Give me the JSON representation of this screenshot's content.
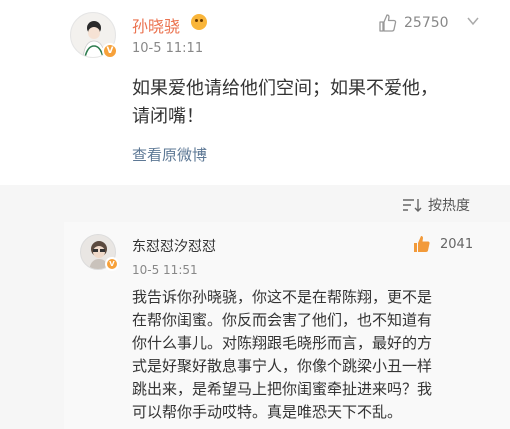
{
  "post": {
    "author_name": "孙晓骁",
    "time": "10-5 11:11",
    "like_count": "25750",
    "text_line1": "如果爱他请给他们空间；如果不爱他，",
    "text_line2": "请闭嘴！",
    "view_original_label": "查看原微博"
  },
  "sort": {
    "label": "按热度"
  },
  "comment": {
    "author_name": "东怼怼汐怼怼",
    "time": "10-5 11:51",
    "like_count": "2041",
    "lines": [
      "我告诉你孙晓骁，你这不是在帮陈翔，更不是",
      "在帮你闺蜜。你反而会害了他们，也不知道有",
      "你什么事儿。对陈翔跟毛晓彤而言，最好的方",
      "式是好聚好散息事宁人，你像个跳梁小丑一样",
      "跳出来，是希望马上把你闺蜜牵扯进来吗？我",
      "可以帮你手动哎特。真是唯恐天下不乱。"
    ]
  },
  "colors": {
    "author_accent": "#eb7350",
    "link": "#5d7895",
    "badge": "#f7a13a",
    "comment_like_icon": "#f29a3a"
  },
  "icons": [
    "verified-badge-icon",
    "member-emoji-icon",
    "thumbs-up-icon",
    "more-chevron-icon",
    "sort-icon"
  ]
}
